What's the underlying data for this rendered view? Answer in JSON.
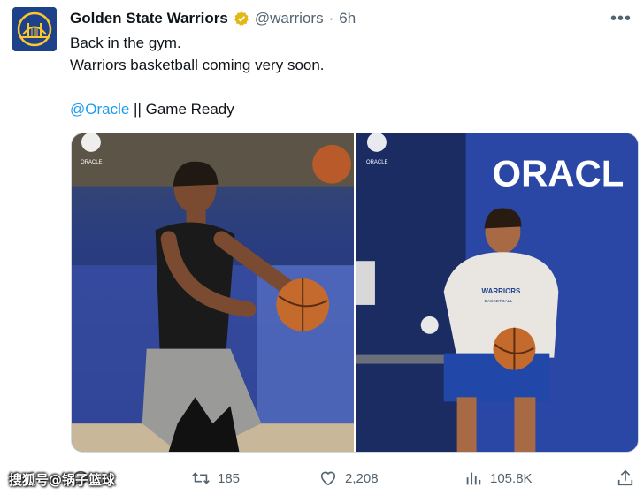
{
  "post": {
    "author_name": "Golden State Warriors",
    "handle": "@warriors",
    "separator": "·",
    "time": "6h",
    "text_line1": "Back in the gym.",
    "text_line2": "Warriors basketball coming very soon.",
    "mention": "@Oracle",
    "text_line3_rest": " || Game Ready"
  },
  "media": {
    "photo1_alt": "Player shooting basketball in gym",
    "photo2_alt": "Player in Warriors hoodie holding basketball",
    "badge_text": "ORACLE",
    "wall_text": "ORACL",
    "hoodie_text": "WARRIORS",
    "hoodie_subtext": "BASKETBALL"
  },
  "actions": {
    "retweets": "185",
    "likes": "2,208",
    "views": "105.8K"
  },
  "watermark": "搜狐号@锅子篮球",
  "colors": {
    "brand_blue": "#1d428a",
    "brand_gold": "#ffc72c",
    "link": "#1d9bf0",
    "muted": "#536471"
  },
  "icons": [
    "more-icon",
    "verified-badge-icon",
    "reply-icon",
    "retweet-icon",
    "like-icon",
    "views-icon",
    "share-icon"
  ]
}
